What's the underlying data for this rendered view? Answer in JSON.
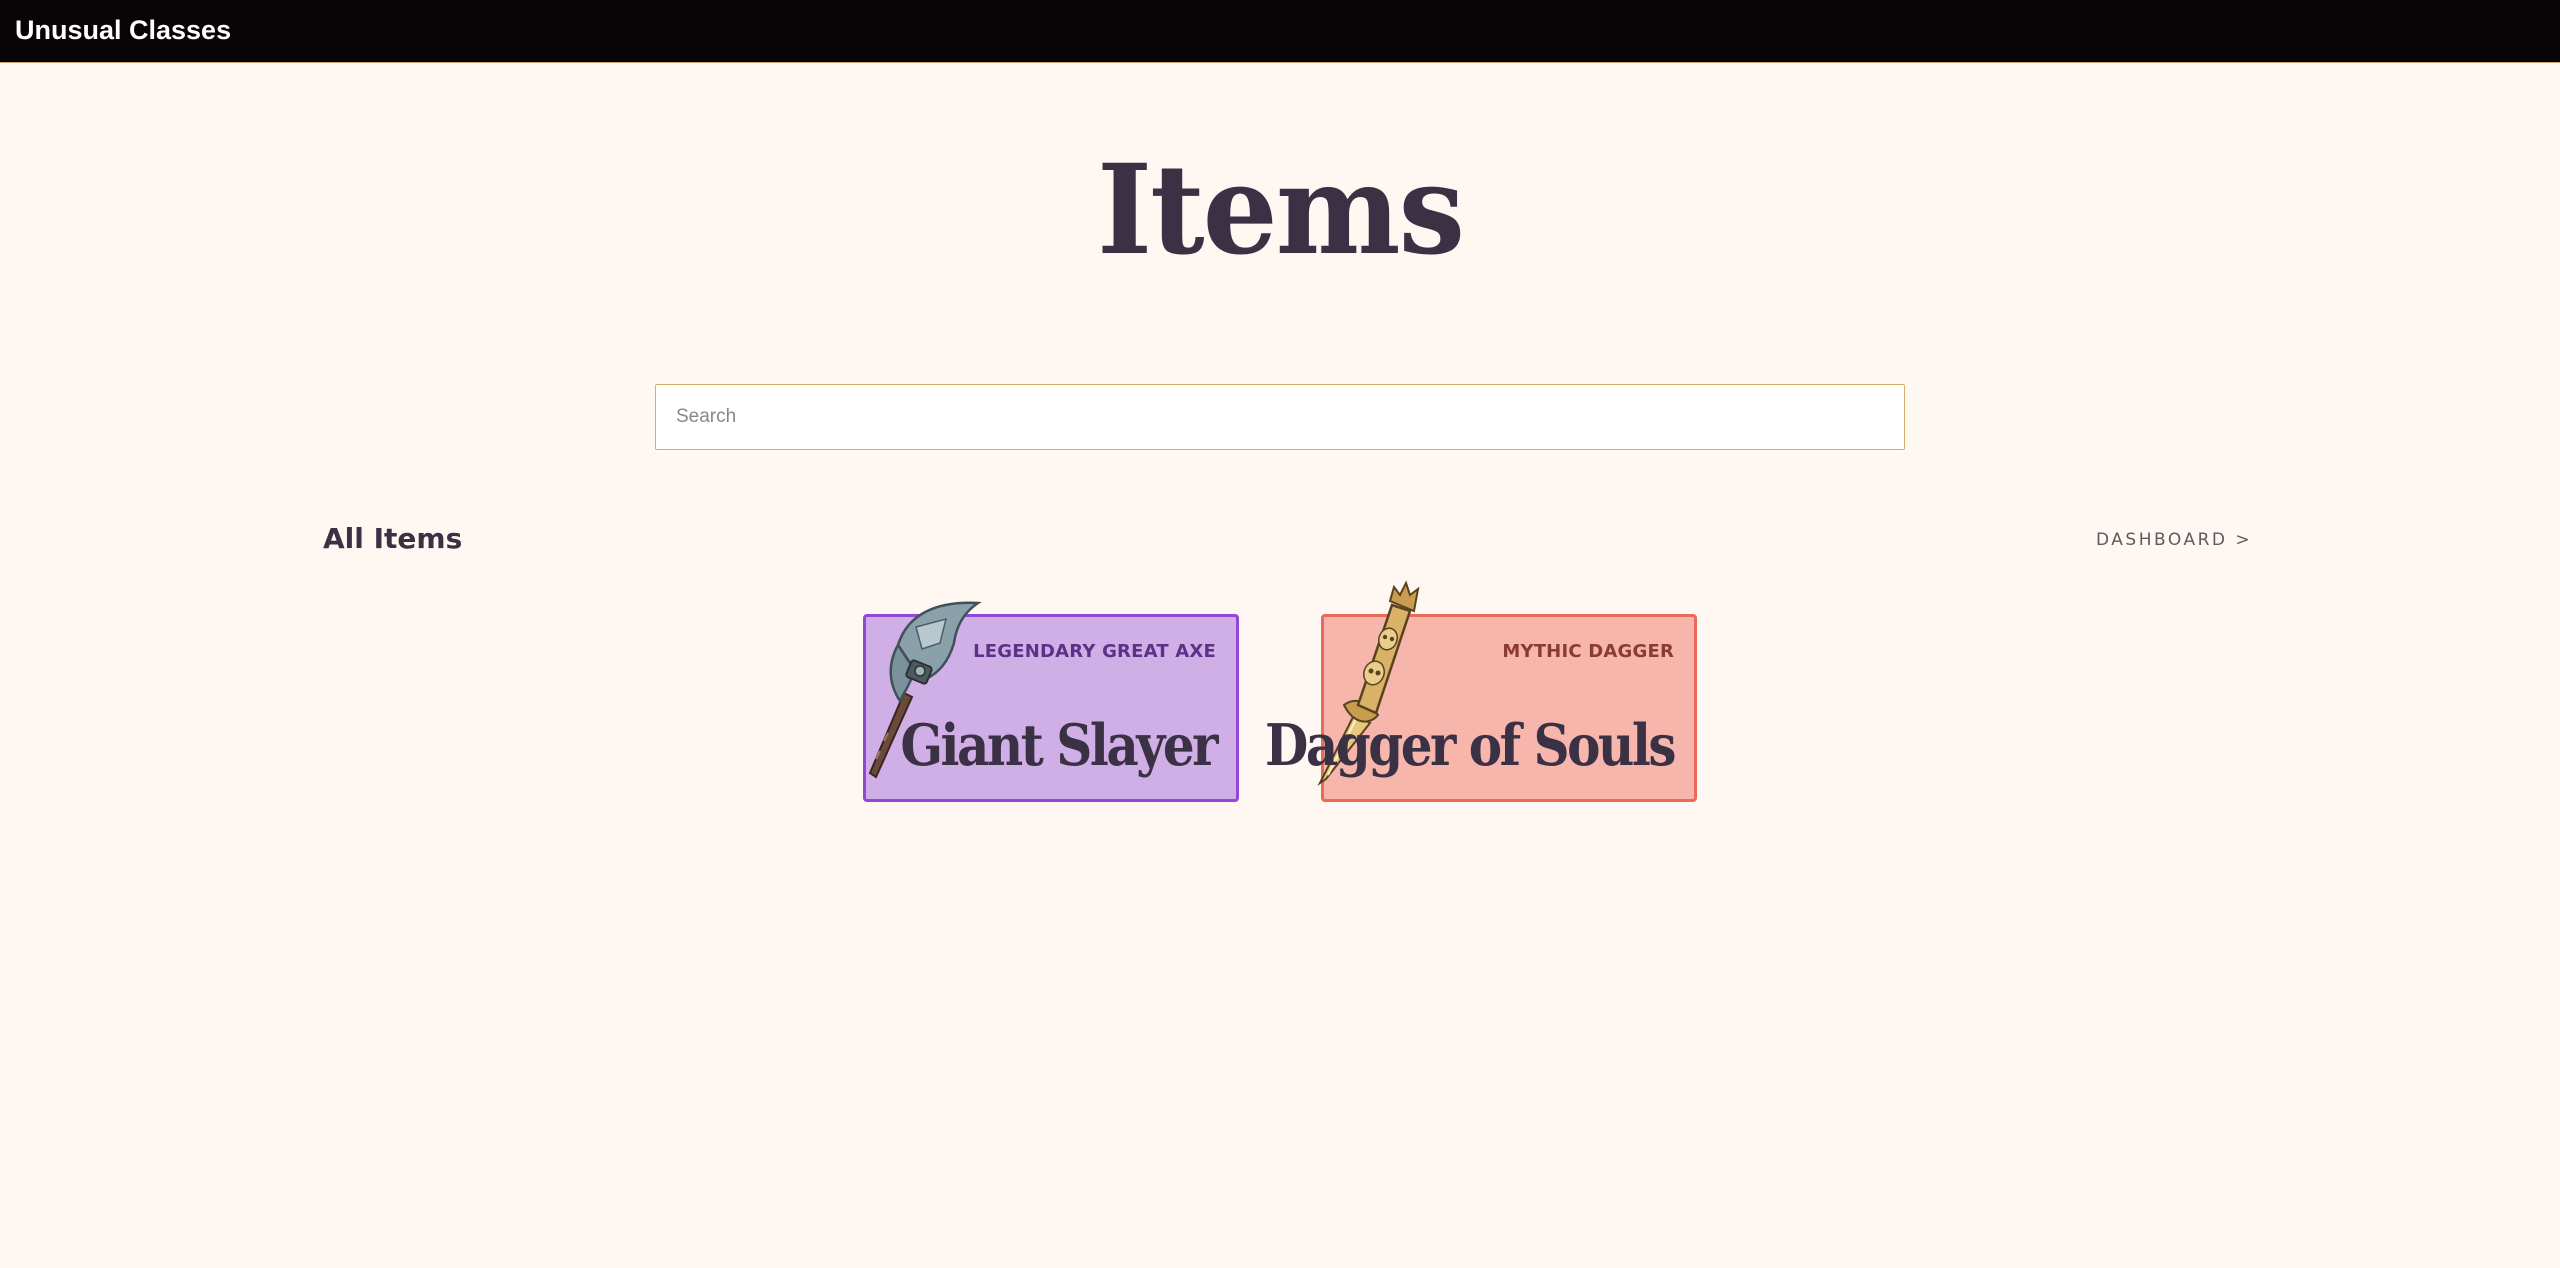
{
  "app": {
    "title": "Unusual Classes"
  },
  "page": {
    "title": "Items"
  },
  "search": {
    "placeholder": "Search",
    "value": ""
  },
  "section": {
    "title": "All Items",
    "dashboard_link": "DASHBOARD >"
  },
  "items": [
    {
      "type": "LEGENDARY GREAT AXE",
      "name": "Giant Slayer",
      "icon": "great-axe-icon",
      "bg": "#d0aee6",
      "border": "#9248d6"
    },
    {
      "type": "MYTHIC DAGGER",
      "name": "Dagger of Souls",
      "icon": "dagger-icon",
      "bg": "#f6b6ac",
      "border": "#e76b59"
    }
  ]
}
